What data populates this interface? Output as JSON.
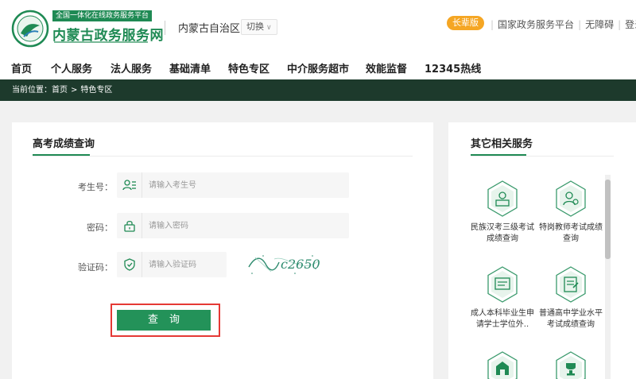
{
  "header": {
    "slogan": "全国一体化在线政务服务平台",
    "site_title": "内蒙古政务服务网",
    "region": "内蒙古自治区",
    "switch_label": "切换",
    "elder_label": "长辈版",
    "links": [
      "国家政务服务平台",
      "无障碍",
      "登录"
    ]
  },
  "nav": {
    "items": [
      "首页",
      "个人服务",
      "法人服务",
      "基础清单",
      "特色专区",
      "中介服务超市",
      "效能监督",
      "12345热线"
    ]
  },
  "breadcrumb": {
    "prefix": "当前位置：",
    "home": "首页",
    "separator": ">",
    "current": "特色专区"
  },
  "form": {
    "title": "高考成绩查询",
    "exam_no": {
      "label": "考生号：",
      "placeholder": "请输入考生号"
    },
    "password": {
      "label": "密码：",
      "placeholder": "请输入密码"
    },
    "captcha": {
      "label": "验证码：",
      "placeholder": "请输入验证码",
      "image_text": "c2650"
    },
    "submit_label": "查询"
  },
  "side": {
    "title": "其它相关服务",
    "services": [
      {
        "label": "民族汉考三级考试成绩查询",
        "icon": "certificate-icon"
      },
      {
        "label": "特岗教师考试成绩查询",
        "icon": "teacher-icon"
      },
      {
        "label": "成人本科毕业生申请学士学位外..",
        "icon": "diploma-icon"
      },
      {
        "label": "普通高中学业水平考试成绩查询",
        "icon": "exam-paper-icon"
      },
      {
        "label": "",
        "icon": "school-icon"
      },
      {
        "label": "",
        "icon": "trophy-icon"
      }
    ]
  },
  "colors": {
    "brand_green": "#1f8a54",
    "button_green": "#239259",
    "breadcrumb_bg": "#1d3a2c",
    "elder_orange": "#f5a623",
    "highlight_red": "#e53935"
  }
}
